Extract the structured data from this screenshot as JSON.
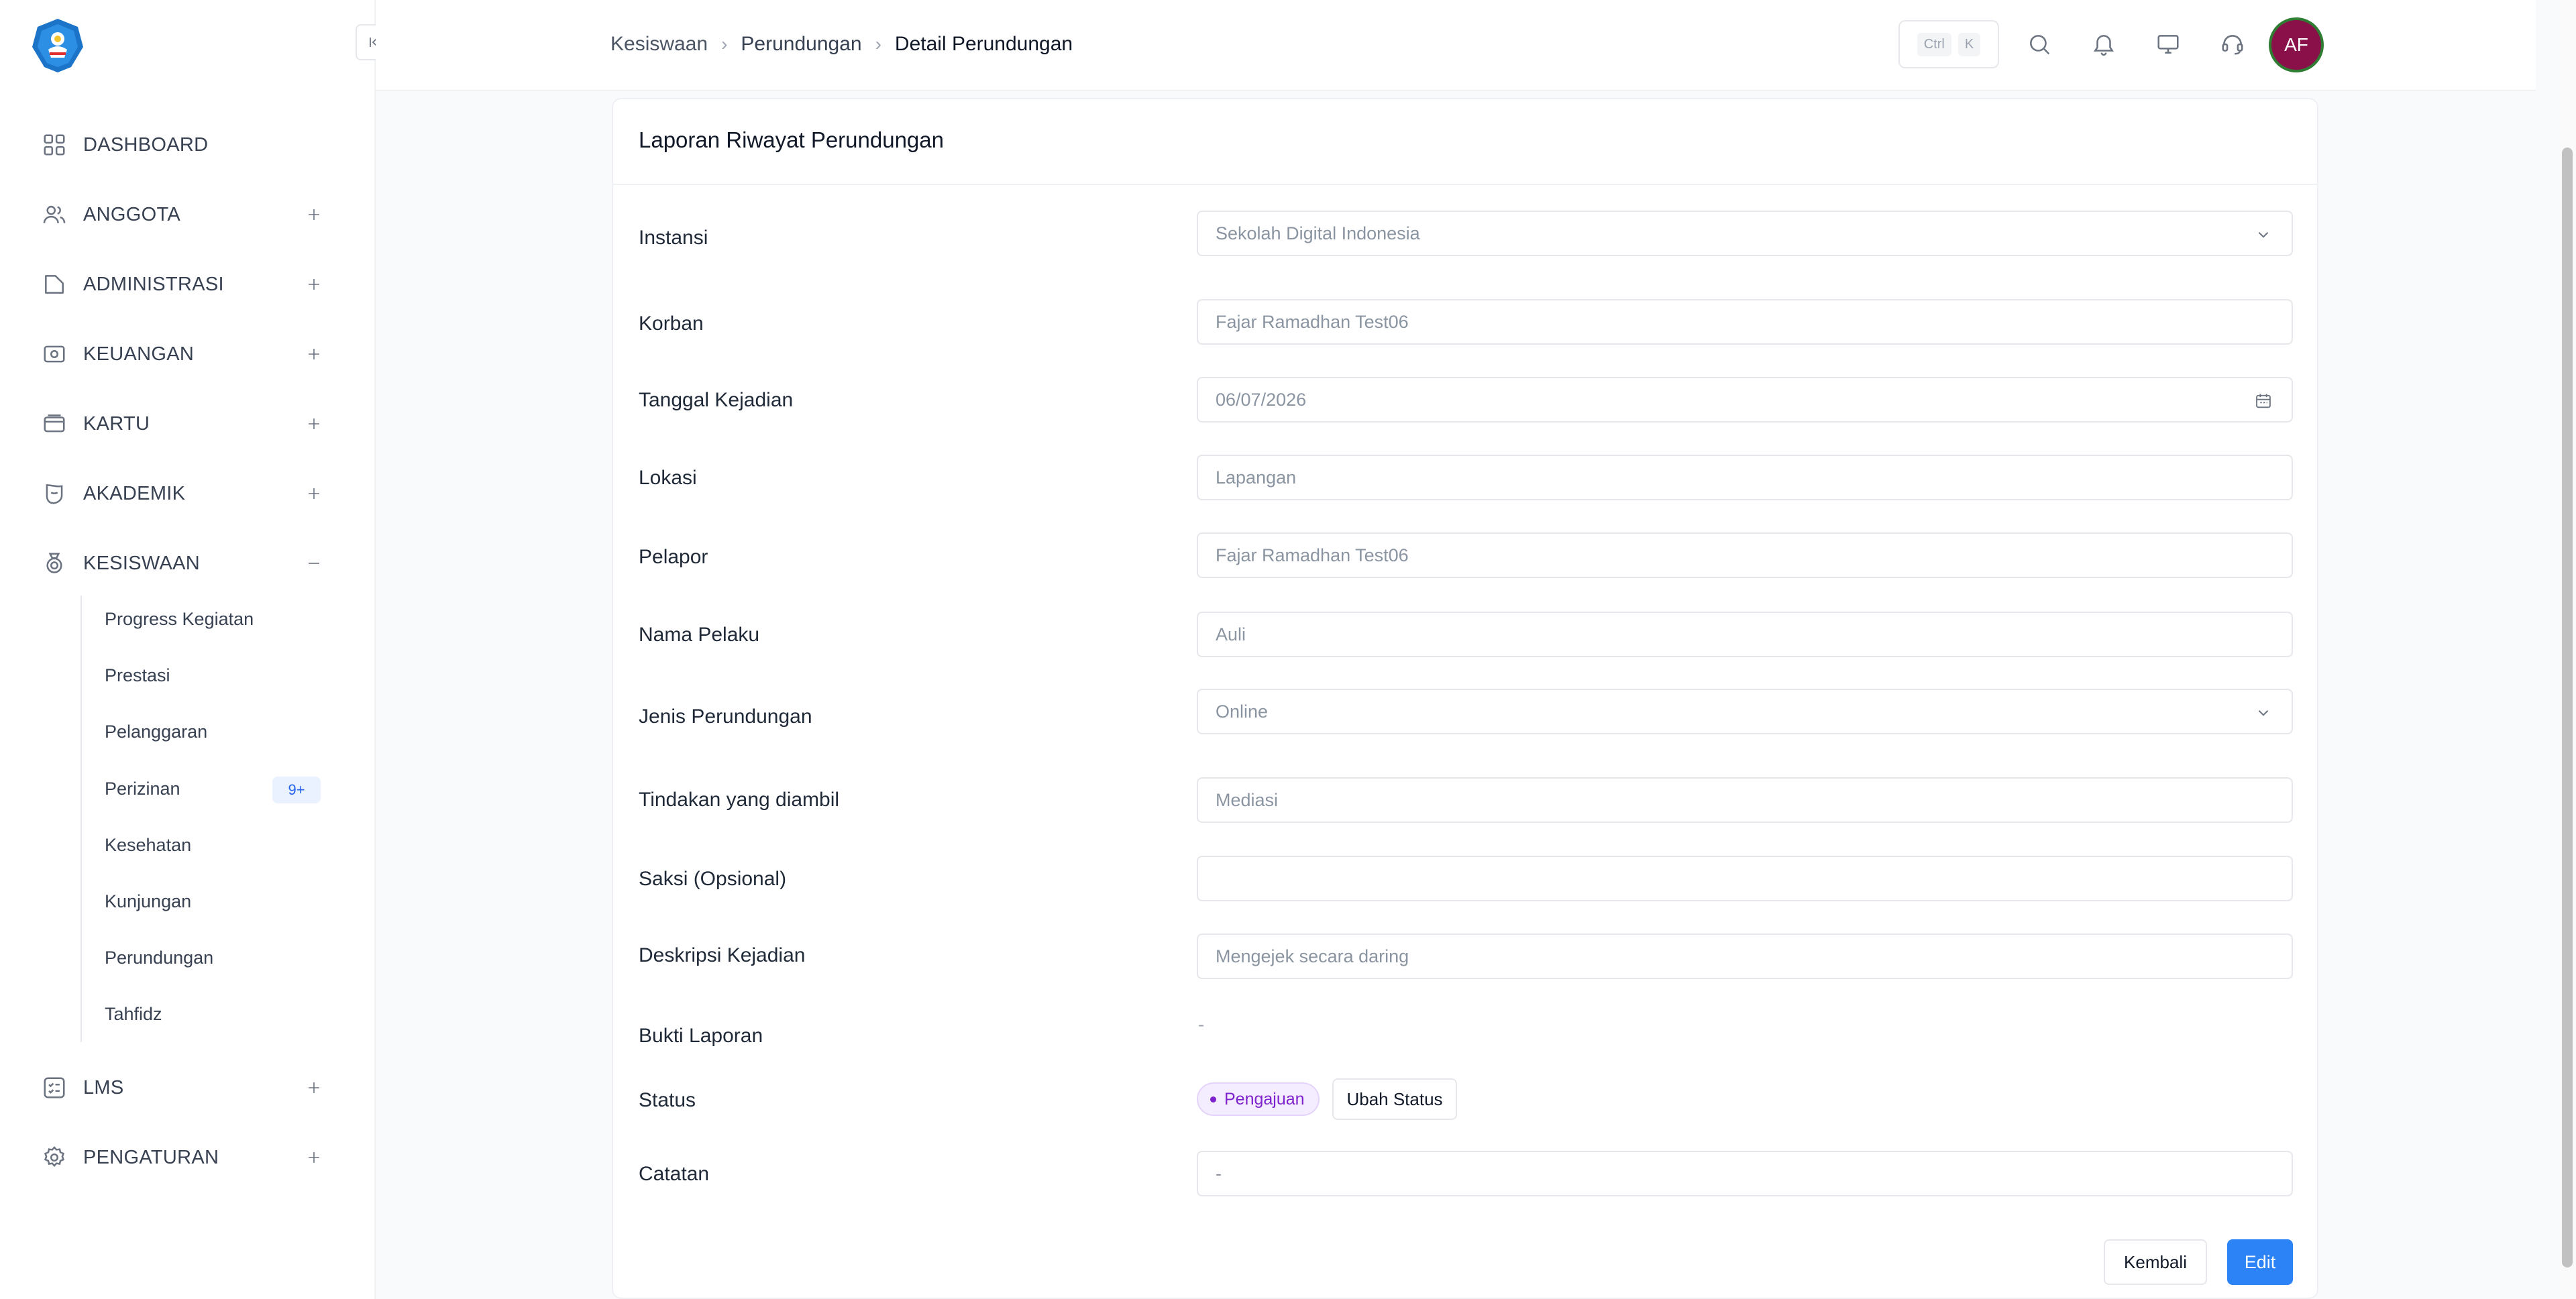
{
  "sidebar": {
    "items": [
      {
        "label": "DASHBOARD",
        "icon": "dashboard-icon"
      },
      {
        "label": "ANGGOTA",
        "icon": "users-icon",
        "toggle": "+"
      },
      {
        "label": "ADMINISTRASI",
        "icon": "folder-icon",
        "toggle": "+"
      },
      {
        "label": "KEUANGAN",
        "icon": "money-icon",
        "toggle": "+"
      },
      {
        "label": "KARTU",
        "icon": "card-icon",
        "toggle": "+"
      },
      {
        "label": "AKADEMIK",
        "icon": "academic-icon",
        "toggle": "+"
      },
      {
        "label": "KESISWAAN",
        "icon": "medal-icon",
        "toggle": "−"
      },
      {
        "label": "LMS",
        "icon": "checklist-icon",
        "toggle": "+"
      },
      {
        "label": "PENGATURAN",
        "icon": "gear-icon",
        "toggle": "+"
      }
    ],
    "subitems": [
      {
        "label": "Progress Kegiatan"
      },
      {
        "label": "Prestasi"
      },
      {
        "label": "Pelanggaran"
      },
      {
        "label": "Perizinan",
        "badge": "9+"
      },
      {
        "label": "Kesehatan"
      },
      {
        "label": "Kunjungan"
      },
      {
        "label": "Perundungan"
      },
      {
        "label": "Tahfidz"
      }
    ]
  },
  "header": {
    "breadcrumb": [
      "Kesiswaan",
      "Perundungan",
      "Detail Perundungan"
    ],
    "shortcut": {
      "ctrl": "Ctrl",
      "key": "K"
    },
    "avatar_initials": "AF"
  },
  "card": {
    "title": "Laporan Riwayat Perundungan",
    "fields": [
      {
        "label": "Instansi",
        "value": "Sekolah Digital Indonesia",
        "type": "select"
      },
      {
        "label": "Korban",
        "value": "Fajar Ramadhan Test06",
        "type": "text"
      },
      {
        "label": "Tanggal Kejadian",
        "value": "06/07/2026",
        "type": "date"
      },
      {
        "label": "Lokasi",
        "value": "Lapangan",
        "type": "text"
      },
      {
        "label": "Pelapor",
        "value": "Fajar Ramadhan Test06",
        "type": "text"
      },
      {
        "label": "Nama Pelaku",
        "value": "Auli",
        "type": "text"
      },
      {
        "label": "Jenis Perundungan",
        "value": "Online",
        "type": "select"
      },
      {
        "label": "Tindakan yang diambil",
        "value": "Mediasi",
        "type": "text"
      },
      {
        "label": "Saksi (Opsional)",
        "value": "",
        "type": "text"
      },
      {
        "label": "Deskripsi Kejadian",
        "value": "Mengejek secara daring",
        "type": "text"
      }
    ],
    "bukti": {
      "label": "Bukti Laporan",
      "value": "-"
    },
    "status": {
      "label": "Status",
      "value": "Pengajuan",
      "button": "Ubah Status"
    },
    "catatan": {
      "label": "Catatan",
      "value": "-"
    },
    "actions": {
      "back": "Kembali",
      "edit": "Edit"
    }
  },
  "colors": {
    "primary": "#2b83f6",
    "status_purple": "#7e22ce",
    "avatar": "#8a1049"
  }
}
